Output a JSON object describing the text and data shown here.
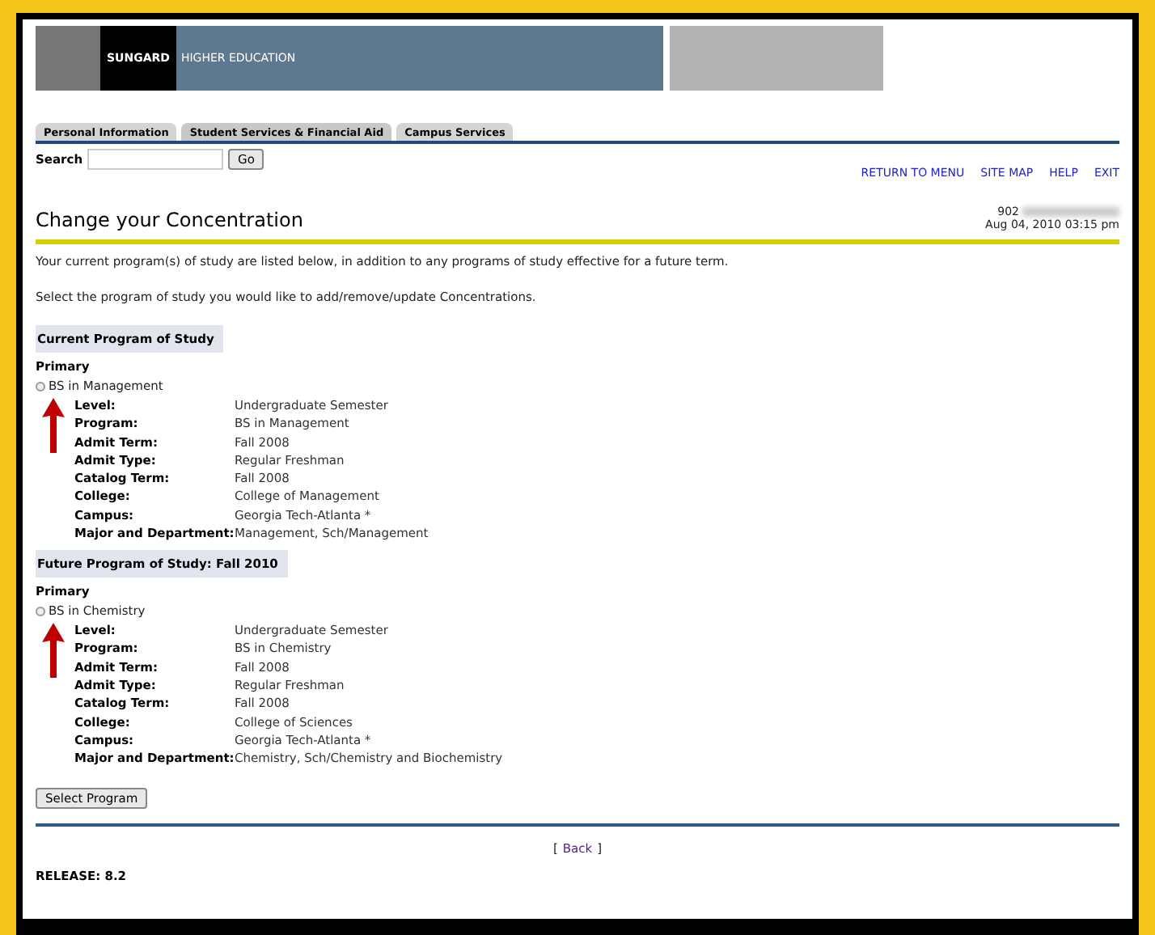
{
  "banner": {
    "brand": "SUNGARD",
    "subtitle": "HIGHER EDUCATION"
  },
  "tabs": [
    {
      "label": "Personal Information",
      "selected": false
    },
    {
      "label": "Student Services & Financial Aid",
      "selected": true
    },
    {
      "label": "Campus Services",
      "selected": false
    }
  ],
  "search": {
    "label": "Search",
    "button": "Go"
  },
  "top_links": [
    "RETURN TO MENU",
    "SITE MAP",
    "HELP",
    "EXIT"
  ],
  "page_title": "Change your Concentration",
  "user_id": "902",
  "timestamp": "Aug 04, 2010 03:15 pm",
  "intro": [
    "Your current program(s) of study are listed below, in addition to any programs of study effective for a future term.",
    "Select the program of study you would like to add/remove/update Concentrations."
  ],
  "sections": [
    {
      "heading": "Current Program of Study",
      "subheading": "Primary",
      "option": {
        "label": "BS in Management",
        "selected": false
      },
      "details": [
        {
          "label": "Level:",
          "value": "Undergraduate Semester"
        },
        {
          "label": "Program:",
          "value": "BS in Management"
        },
        {
          "label": "Admit Term:",
          "value": "Fall 2008"
        },
        {
          "label": "Admit Type:",
          "value": "Regular Freshman"
        },
        {
          "label": "Catalog Term:",
          "value": "Fall 2008"
        },
        {
          "label": "College:",
          "value": "College of Management"
        },
        {
          "label": "Campus:",
          "value": "Georgia Tech-Atlanta *"
        },
        {
          "label": "Major and Department:",
          "value": "Management, Sch/Management"
        }
      ]
    },
    {
      "heading": "Future Program of Study: Fall 2010",
      "subheading": "Primary",
      "option": {
        "label": "BS in Chemistry",
        "selected": false
      },
      "details": [
        {
          "label": "Level:",
          "value": "Undergraduate Semester"
        },
        {
          "label": "Program:",
          "value": "BS in Chemistry"
        },
        {
          "label": "Admit Term:",
          "value": "Fall 2008"
        },
        {
          "label": "Admit Type:",
          "value": "Regular Freshman"
        },
        {
          "label": "Catalog Term:",
          "value": "Fall 2008"
        },
        {
          "label": "College:",
          "value": "College of Sciences"
        },
        {
          "label": "Campus:",
          "value": "Georgia Tech-Atlanta *"
        },
        {
          "label": "Major and Department:",
          "value": "Chemistry, Sch/Chemistry and Biochemistry"
        }
      ]
    }
  ],
  "submit_button": "Select Program",
  "back": {
    "open": "[",
    "link": "Back",
    "close": "]"
  },
  "release": "RELEASE: 8.2"
}
